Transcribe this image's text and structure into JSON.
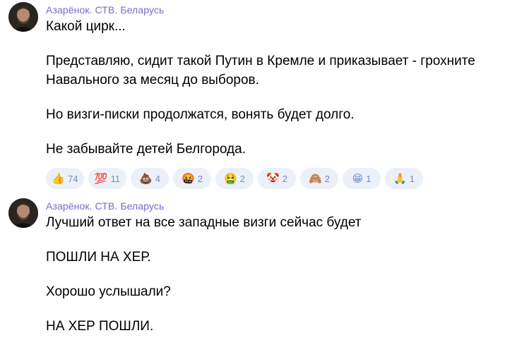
{
  "messages": [
    {
      "sender": "Азарёнок. СТВ. Беларусь",
      "paragraphs": [
        "Какой цирк...",
        "Представляю, сидит такой Путин в Кремле и приказывает - грохните Навального за месяц до выборов.",
        "Но визги-писки продолжатся, вонять будет долго.",
        "Не забывайте детей Белгорода."
      ],
      "reactions": [
        {
          "emoji": "👍",
          "icon": "thumbs-up-icon",
          "count": "74"
        },
        {
          "emoji": "💯",
          "icon": "hundred-points-icon",
          "count": "11"
        },
        {
          "emoji": "💩",
          "icon": "pile-of-poo-icon",
          "count": "4"
        },
        {
          "emoji": "🤬",
          "icon": "cursing-face-icon",
          "count": "2"
        },
        {
          "emoji": "🤮",
          "icon": "vomiting-face-icon",
          "count": "2"
        },
        {
          "emoji": "🤡",
          "icon": "clown-face-icon",
          "count": "2"
        },
        {
          "emoji": "🙈",
          "icon": "see-no-evil-monkey-icon",
          "count": "2"
        },
        {
          "emoji": "😁",
          "icon": "grinning-face-icon",
          "count": "1"
        },
        {
          "emoji": "🙏",
          "icon": "folded-hands-icon",
          "count": "1"
        }
      ]
    },
    {
      "sender": "Азарёнок. СТВ. Беларусь",
      "paragraphs": [
        "Лучший ответ на все западные визги сейчас будет",
        "ПОШЛИ НА ХЕР.",
        "Хорошо услышали?",
        "НА ХЕР ПОШЛИ."
      ]
    }
  ],
  "colors": {
    "sender": "#7b69c8",
    "reaction_bg": "#ecf0f8",
    "reaction_count": "#6f8ac6"
  }
}
